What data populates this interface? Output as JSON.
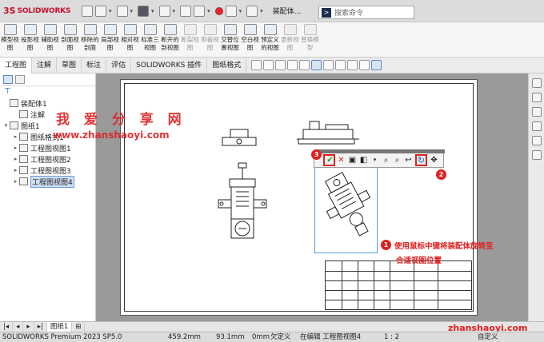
{
  "app": {
    "brand": "SOLIDWORKS",
    "doc_title": "装配体...",
    "search_placeholder": "搜索命令"
  },
  "ribbon": [
    {
      "label": "模型视图",
      "enabled": true
    },
    {
      "label": "投影视图",
      "enabled": true
    },
    {
      "label": "辅助视图",
      "enabled": true
    },
    {
      "label": "剖面视图",
      "enabled": true
    },
    {
      "label": "移除的剖面",
      "enabled": true
    },
    {
      "label": "局部视图",
      "enabled": true
    },
    {
      "label": "相对视图",
      "enabled": true
    },
    {
      "label": "标准三视图",
      "enabled": true
    },
    {
      "label": "断开的剖视图",
      "enabled": true
    },
    {
      "label": "断裂视图",
      "enabled": false
    },
    {
      "label": "剪裁视图",
      "enabled": false
    },
    {
      "label": "交替位置视图",
      "enabled": true
    },
    {
      "label": "空白视图",
      "enabled": true
    },
    {
      "label": "预定义的视图",
      "enabled": true
    },
    {
      "label": "更新视图",
      "enabled": false
    },
    {
      "label": "替换模型",
      "enabled": false
    }
  ],
  "tabs": [
    "工程图",
    "注解",
    "草图",
    "标注",
    "评估",
    "SOLIDWORKS 插件",
    "图纸格式"
  ],
  "tree": [
    {
      "label": "装配体1",
      "depth": 0,
      "toggle": ""
    },
    {
      "label": "注解",
      "depth": 1,
      "toggle": ""
    },
    {
      "label": "图纸1",
      "depth": 0,
      "toggle": "▾"
    },
    {
      "label": "图纸格式1",
      "depth": 1,
      "toggle": "▸"
    },
    {
      "label": "工程图视图1",
      "depth": 1,
      "toggle": "▸"
    },
    {
      "label": "工程图视图2",
      "depth": 1,
      "toggle": "▸"
    },
    {
      "label": "工程图视图3",
      "depth": 1,
      "toggle": "▸"
    },
    {
      "label": "工程图视图4",
      "depth": 1,
      "toggle": "▸",
      "selected": true
    }
  ],
  "watermark": {
    "title": "我 爱 分 享 网",
    "url": "www.zhanshaoyi.com",
    "corner": "zhanshaoyi.com"
  },
  "annotations": {
    "badge1": "1",
    "badge2": "2",
    "badge3": "3",
    "line1": "使用鼠标中键将装配体旋转至",
    "line2": "合适视图位置"
  },
  "sheet_tab": "图纸1",
  "status": {
    "app": "SOLIDWORKS Premium 2023 SP5.0",
    "x": "459.2mm",
    "y": "93.1mm",
    "z": "0mm",
    "def": "欠定义",
    "edit": "在编辑 工程图视图4",
    "scale": "1 : 2",
    "units": "自定义"
  },
  "colors": {
    "accent": "#e02020",
    "selection": "#5b9be0"
  }
}
